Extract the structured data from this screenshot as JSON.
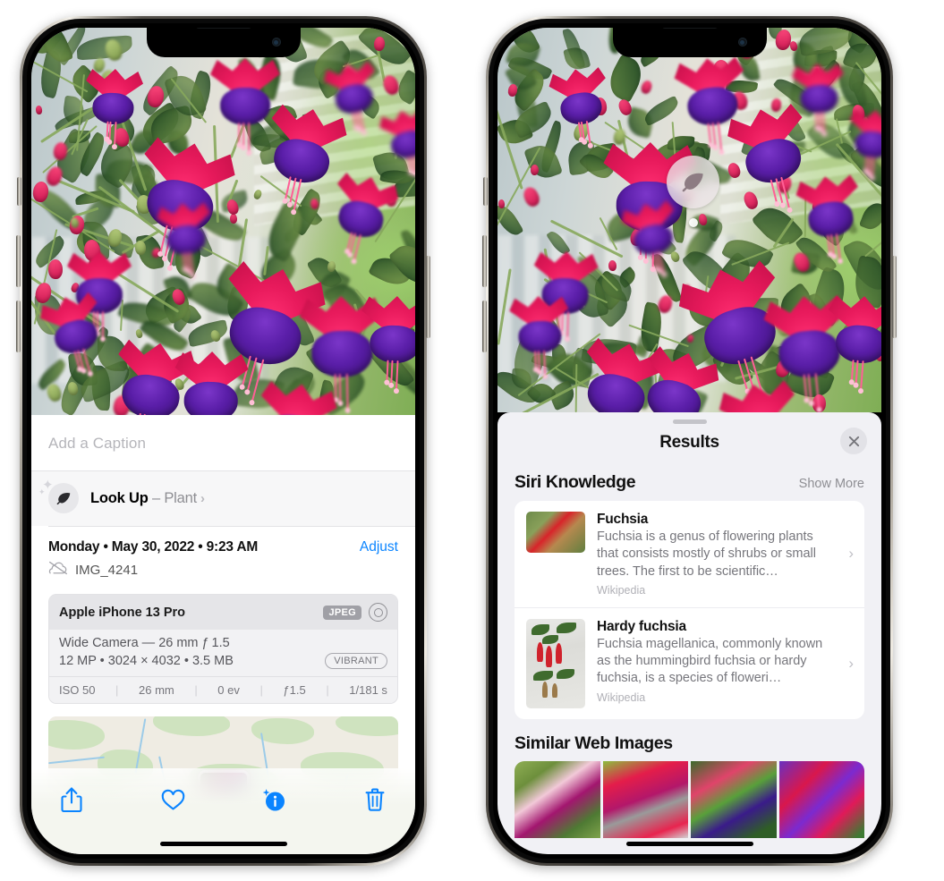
{
  "left_phone": {
    "name": "iphone-photos-info",
    "photo_alt": "fuchsia-flowers-hanging-basket",
    "caption_placeholder": "Add a Caption",
    "lookup": {
      "icon": "leaf-icon",
      "label": "Look Up",
      "dash": "–",
      "subject": "Plant",
      "chevron": "›"
    },
    "date": "Monday • May 30, 2022 • 9:23 AM",
    "adjust_label": "Adjust",
    "cloud_icon": "cloud-slash-icon",
    "filename": "IMG_4241",
    "camera_card": {
      "model": "Apple iPhone 13 Pro",
      "format_badge": "JPEG",
      "raw_icon": "raw-ring-icon",
      "lens_line": "Wide Camera — 26 mm ƒ 1.5",
      "specs_line": "12 MP • 3024 × 4032 • 3.5 MB",
      "style_badge": "VIBRANT",
      "exif": [
        "ISO 50",
        "26 mm",
        "0 ev",
        "ƒ1.5",
        "1/181 s"
      ]
    },
    "map_alt": "photo-location-map",
    "toolbar": [
      {
        "name": "share-button",
        "icon": "share-icon"
      },
      {
        "name": "favorite-button",
        "icon": "heart-icon"
      },
      {
        "name": "info-button",
        "icon": "info-sparkle-icon"
      },
      {
        "name": "delete-button",
        "icon": "trash-icon"
      }
    ],
    "accent_color": "#0a84ff"
  },
  "right_phone": {
    "name": "iphone-visual-lookup-results",
    "badge": {
      "icon": "leaf-icon"
    },
    "sheet": {
      "title": "Results",
      "close_icon": "close-icon",
      "sections": [
        {
          "title": "Siri Knowledge",
          "action_label": "Show More",
          "items": [
            {
              "title": "Fuchsia",
              "description": "Fuchsia is a genus of flowering plants that consists mostly of shrubs or small trees. The first to be scientific…",
              "source": "Wikipedia",
              "thumb_alt": "fuchsia-red-flowers-thumbnail",
              "chevron": "›"
            },
            {
              "title": "Hardy fuchsia",
              "description": "Fuchsia magellanica, commonly known as the hummingbird fuchsia or hardy fuchsia, is a species of floweri…",
              "source": "Wikipedia",
              "thumb_alt": "hardy-fuchsia-specimen-thumbnail",
              "chevron": "›"
            }
          ]
        },
        {
          "title": "Similar Web Images",
          "images": [
            {
              "alt": "fuchsia-web-image-1"
            },
            {
              "alt": "fuchsia-web-image-2"
            },
            {
              "alt": "fuchsia-web-image-3"
            },
            {
              "alt": "fuchsia-web-image-4"
            }
          ]
        }
      ]
    }
  }
}
